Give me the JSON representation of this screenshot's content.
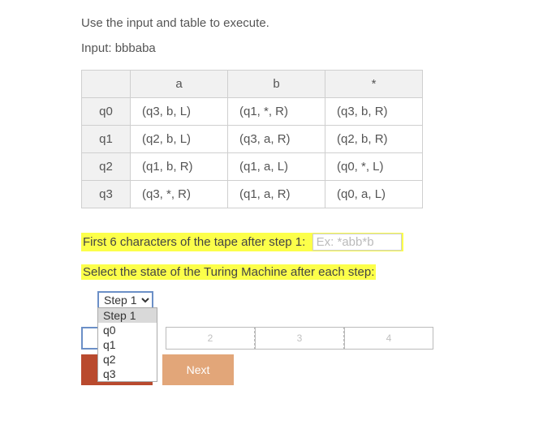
{
  "prompt": "Use the input and table to execute.",
  "input_label": "Input:",
  "input_value": "bbbaba",
  "table": {
    "columns": [
      "a",
      "b",
      "*"
    ],
    "rows": [
      {
        "state": "q0",
        "a": "(q3, b, L)",
        "b": "(q1, *, R)",
        "star": "(q3, b, R)"
      },
      {
        "state": "q1",
        "a": "(q2, b, L)",
        "b": "(q3, a, R)",
        "star": "(q2, b, R)"
      },
      {
        "state": "q2",
        "a": "(q1, b, R)",
        "b": "(q1, a, L)",
        "star": "(q0, *, L)"
      },
      {
        "state": "q3",
        "a": "(q3, *, R)",
        "b": "(q1, a, R)",
        "star": "(q0, a, L)"
      }
    ]
  },
  "question1": {
    "label": "First 6 characters of the tape after step 1:",
    "placeholder": "Ex: *abb*b"
  },
  "question2": {
    "label": "Select the state of the Turing Machine after each step:"
  },
  "step_select": {
    "selected": "Step 1",
    "options": [
      "Step 1",
      "q0",
      "q1",
      "q2",
      "q3"
    ]
  },
  "step_slots": [
    "",
    "2",
    "3",
    "4"
  ],
  "buttons": {
    "prev": "",
    "next": "Next"
  }
}
